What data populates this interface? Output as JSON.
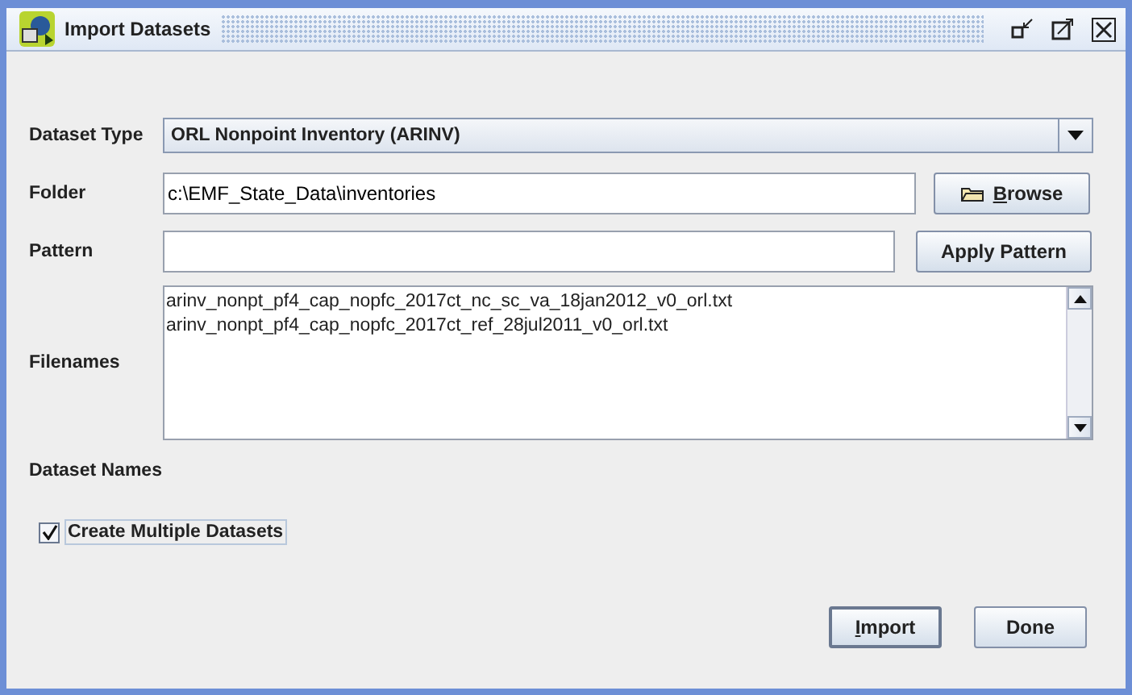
{
  "window": {
    "title": "Import Datasets"
  },
  "dataset_type": {
    "label": "Dataset Type",
    "value": "ORL Nonpoint Inventory (ARINV)"
  },
  "folder": {
    "label": "Folder",
    "value": "c:\\EMF_State_Data\\inventories",
    "button": {
      "label": "Browse",
      "mnemonic": true
    }
  },
  "pattern": {
    "label": "Pattern",
    "button": {
      "label": "Apply Pattern",
      "mnemonic": false
    }
  },
  "filenames": {
    "label": "Filenames",
    "items": [
      {
        "text": "arinv_nonpt_pf4_cap_nopfc_2017ct_nc_sc_va_18jan2012_v0_orl.txt",
        "selected": false
      },
      {
        "text": "arinv_nonpt_pf4_cap_nopfc_2017ct_ref_28jul2011_v0_orl.txt",
        "selected": false
      }
    ]
  },
  "dataset_names": {
    "label": "Dataset Names"
  },
  "create_multiple": {
    "label": "Create Multiple Datasets",
    "checked": true
  },
  "buttons": [
    {
      "label": "Import",
      "mnemonic": true,
      "default": true
    },
    {
      "label": "Done",
      "mnemonic": false,
      "default": false
    }
  ]
}
